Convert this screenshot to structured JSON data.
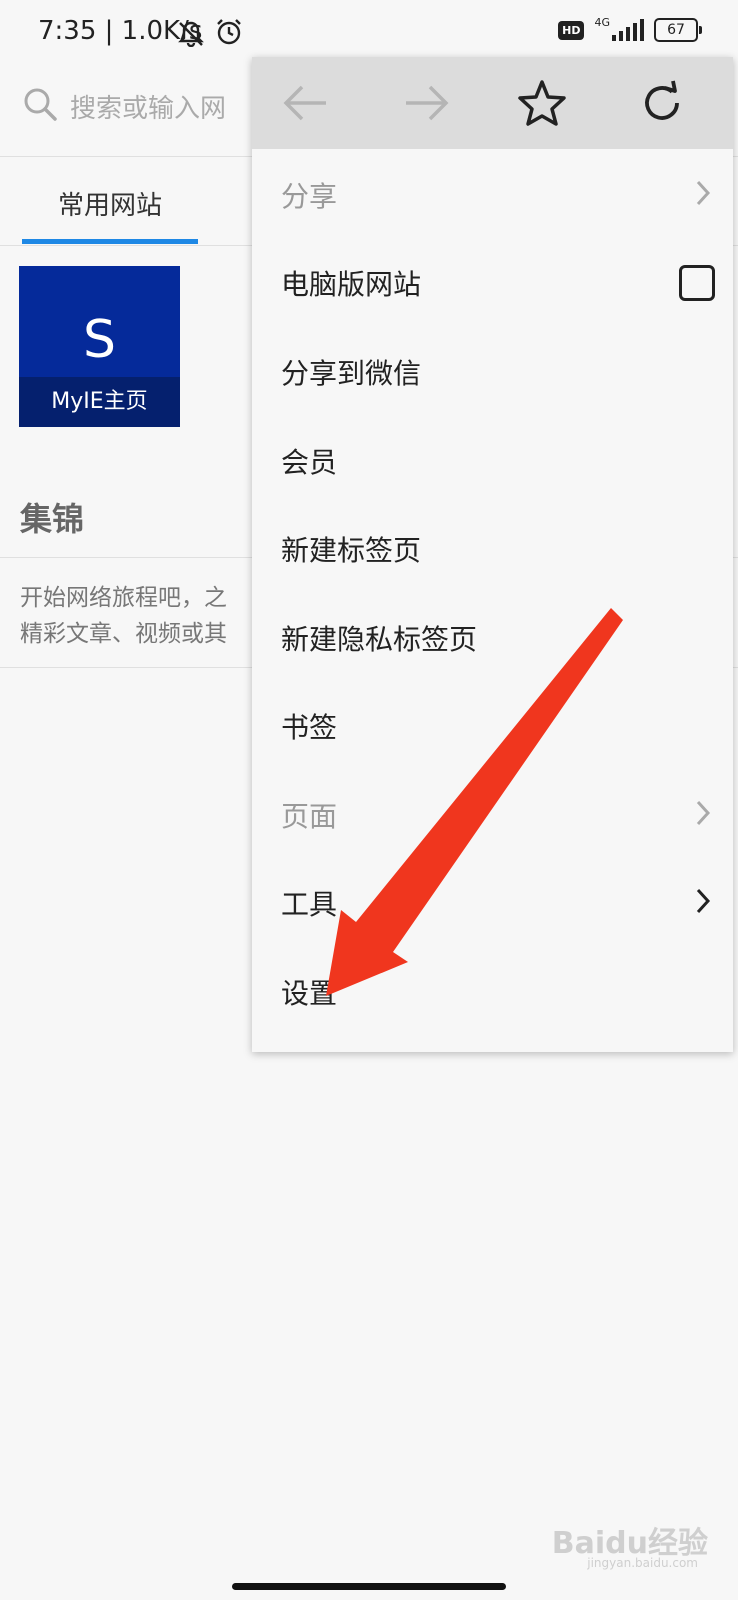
{
  "status_bar": {
    "time": "7:35 | 1.0K/s",
    "network_type": "4G",
    "hd_label": "HD",
    "battery": "67"
  },
  "search": {
    "placeholder": "搜索或输入网"
  },
  "tabs": [
    {
      "label": "常用网站",
      "active": true
    }
  ],
  "shortcuts": [
    {
      "letter": "S",
      "label": "MyIE主页"
    }
  ],
  "collections": {
    "title": "集锦",
    "description": "开始网络旅程吧，之\n精彩文章、视频或其"
  },
  "menu": {
    "toolbar": {
      "back_icon": "arrow-left-icon",
      "forward_icon": "arrow-right-icon",
      "bookmark_icon": "star-icon",
      "reload_icon": "reload-icon"
    },
    "items": [
      {
        "label": "分享",
        "disabled": true,
        "trailing": "chevron"
      },
      {
        "label": "电脑版网站",
        "disabled": false,
        "trailing": "checkbox",
        "checked": false
      },
      {
        "label": "分享到微信",
        "disabled": false,
        "trailing": ""
      },
      {
        "label": "会员",
        "disabled": false,
        "trailing": ""
      },
      {
        "label": "新建标签页",
        "disabled": false,
        "trailing": ""
      },
      {
        "label": "新建隐私标签页",
        "disabled": false,
        "trailing": ""
      },
      {
        "label": "书签",
        "disabled": false,
        "trailing": ""
      },
      {
        "label": "页面",
        "disabled": true,
        "trailing": "chevron"
      },
      {
        "label": "工具",
        "disabled": false,
        "trailing": "chevron"
      },
      {
        "label": "设置",
        "disabled": false,
        "trailing": ""
      }
    ]
  },
  "colors": {
    "accent": "#1e88e5",
    "tile_bg": "#052a9a",
    "annotation_arrow": "#f0361e"
  },
  "watermark": {
    "brand": "Baidu经验",
    "url": "jingyan.baidu.com"
  }
}
